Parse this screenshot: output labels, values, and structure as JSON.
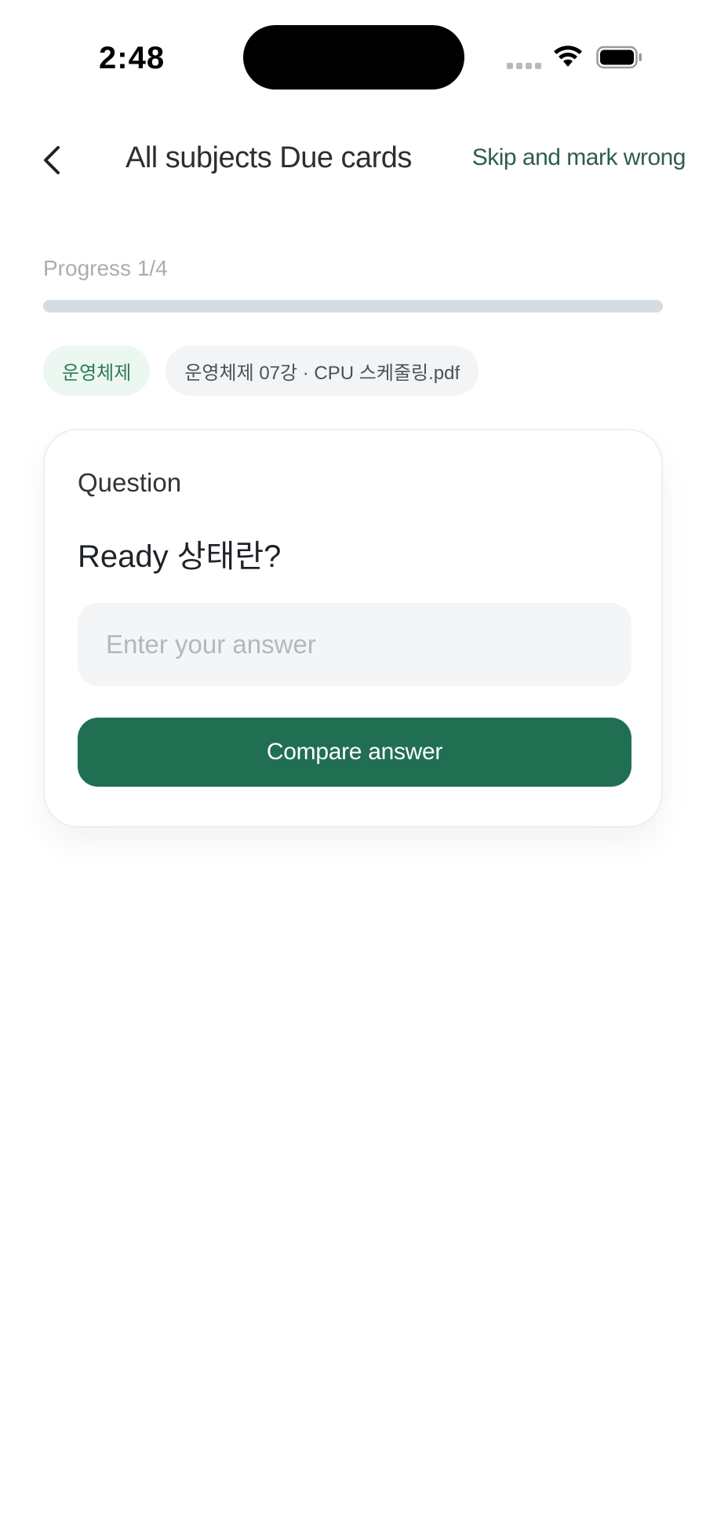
{
  "status_bar": {
    "time": "2:48"
  },
  "header": {
    "back_icon": "chevron-left-icon",
    "title": "All subjects Due cards",
    "skip_label": "Skip and mark wrong"
  },
  "progress": {
    "label": "Progress 1/4",
    "current": 1,
    "total": 4,
    "fill_fraction": 0
  },
  "chips": {
    "subject": "운영체제",
    "file": "운영체제 07강 · CPU 스케줄링.pdf"
  },
  "card": {
    "label": "Question",
    "question": "Ready 상태란?",
    "answer_placeholder": "Enter your answer",
    "answer_value": "",
    "compare_label": "Compare answer"
  },
  "colors": {
    "accent": "#216f53",
    "chip_subject_bg": "#edf7f1",
    "chip_file_bg": "#f3f4f6",
    "progress_track": "#d5dce3"
  }
}
